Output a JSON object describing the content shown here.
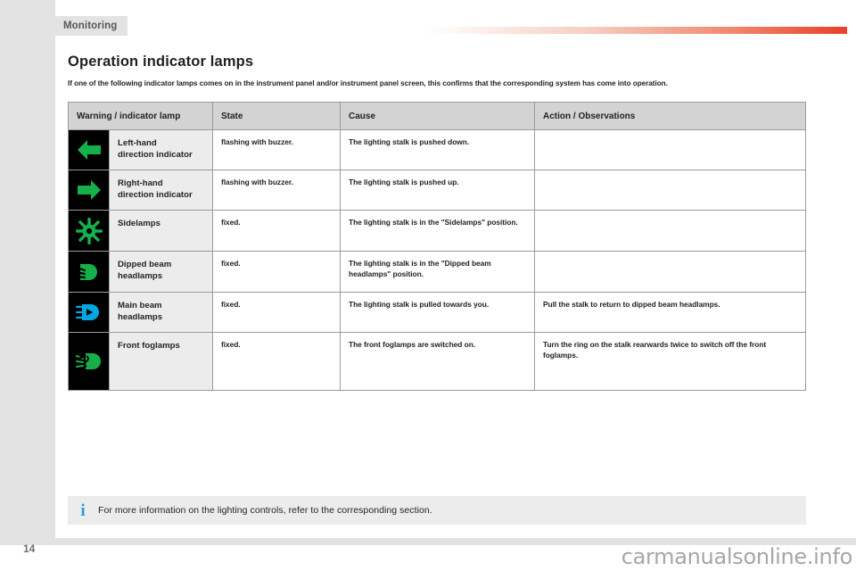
{
  "header": {
    "section_tab": "Monitoring",
    "rule_gradient_from": "#ffffff",
    "rule_gradient_to": "#e8402a"
  },
  "title": "Operation indicator lamps",
  "intro": "If one of the following indicator lamps comes on in the instrument panel and/or instrument panel screen, this confirms that the corresponding system has come into operation.",
  "table": {
    "columns": [
      "Warning / indicator lamp",
      "State",
      "Cause",
      "Action / Observations"
    ],
    "rows": [
      {
        "icon": "arrow-left-green-icon",
        "lamp": "Left-hand\ndirection indicator",
        "lamp_line1": "Left-hand",
        "lamp_line2": "direction indicator",
        "state": "flashing with buzzer.",
        "cause": "The lighting stalk is pushed down.",
        "action": ""
      },
      {
        "icon": "arrow-right-green-icon",
        "lamp_line1": "Right-hand",
        "lamp_line2": "direction indicator",
        "state": "flashing with buzzer.",
        "cause": "The lighting stalk is pushed up.",
        "action": ""
      },
      {
        "icon": "sidelamps-green-icon",
        "lamp_line1": "Sidelamps",
        "lamp_line2": "",
        "state": "fixed.",
        "cause": "The lighting stalk is in the \"Sidelamps\" position.",
        "action": ""
      },
      {
        "icon": "dipped-beam-green-icon",
        "lamp_line1": "Dipped beam",
        "lamp_line2": "headlamps",
        "state": "fixed.",
        "cause": "The lighting stalk is in the \"Dipped beam headlamps\" position.",
        "action": ""
      },
      {
        "icon": "main-beam-blue-icon",
        "lamp_line1": "Main beam",
        "lamp_line2": "headlamps",
        "state": "fixed.",
        "cause": "The lighting stalk is pulled towards you.",
        "action": "Pull the stalk to return to dipped beam headlamps."
      },
      {
        "icon": "front-foglamps-green-icon",
        "lamp_line1": "Front foglamps",
        "lamp_line2": "",
        "state": "fixed.",
        "cause": "The front foglamps are switched on.",
        "action": "Turn the ring on the stalk rearwards twice to switch off the front foglamps."
      }
    ]
  },
  "note": {
    "icon": "information-icon",
    "text": "For more information on the lighting controls, refer to the corresponding section."
  },
  "footer": {
    "page_number": "14",
    "watermark": "carmanualsonline.info"
  },
  "colors": {
    "indicator_green": "#16b04b",
    "indicator_blue": "#00a7e1",
    "info_blue": "#1ba0d8",
    "rule_red": "#e8402a",
    "header_grey": "#d3d3d3",
    "cell_grey": "#ececec"
  }
}
